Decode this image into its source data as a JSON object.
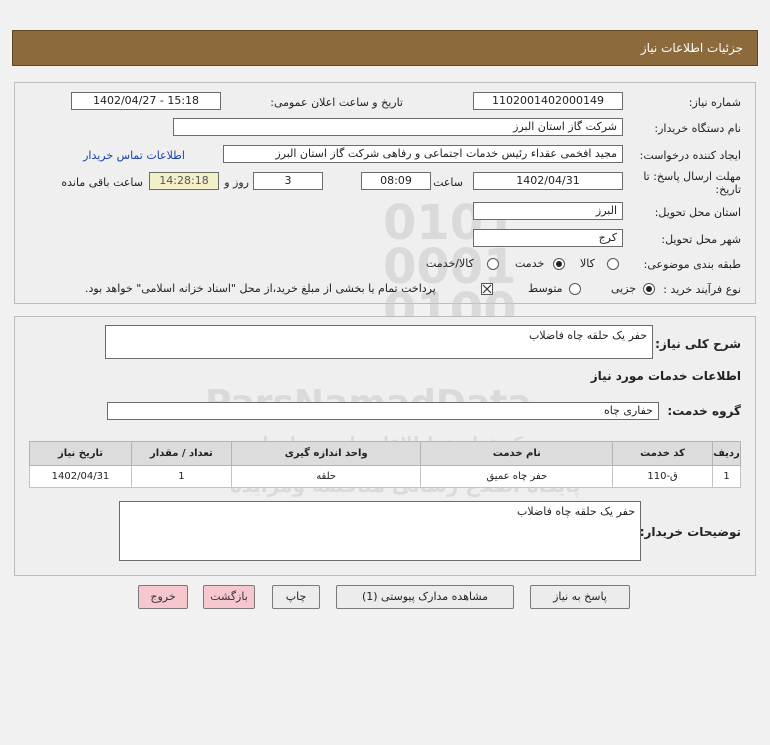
{
  "header": {
    "title": "جزئیات اطلاعات نیاز"
  },
  "need": {
    "number_label": "شماره نیاز:",
    "number_value": "1102001402000149",
    "announce_label": "تاریخ و ساعت اعلان عمومی:",
    "announce_value": "1402/04/27 - 15:18",
    "buyer_label": "نام دستگاه خریدار:",
    "buyer_value": "شرکت گاز استان البرز",
    "requester_label": "ایجاد کننده درخواست:",
    "requester_value": "مجید افخمی عقداء رئیس خدمات اجتماعی و رفاهی شرکت گاز استان البرز",
    "contact_link": "اطلاعات تماس خریدار",
    "deadline_label_1": "مهلت ارسال پاسخ: تا",
    "deadline_label_2": "تاریخ:",
    "deadline_date": "1402/04/31",
    "time_label": "ساعت",
    "deadline_time": "08:09",
    "days_value": "3",
    "days_label": "روز و",
    "remaining_time": "14:28:18",
    "remaining_label": "ساعت باقی مانده",
    "province_label": "استان محل تحویل:",
    "province_value": "البرز",
    "city_label": "شهر محل تحویل:",
    "city_value": "کرج",
    "category_label": "طبقه بندی موضوعی:",
    "category_options": [
      "کالا",
      "خدمت",
      "کالا/خدمت"
    ],
    "category_selected": "خدمت",
    "process_label": "نوع فرآیند خرید :",
    "process_options": [
      "جزیی",
      "متوسط"
    ],
    "process_selected": "جزیی",
    "payment_note": "پرداخت تمام یا بخشی از مبلغ خرید،از محل \"اسناد خزانه اسلامی\" خواهد بود."
  },
  "details": {
    "description_label": "شرح کلی نیاز:",
    "description_value": "حفر یک حلقه چاه فاضلاب",
    "services_title": "اطلاعات خدمات مورد نیاز",
    "service_group_label": "گروه خدمت:",
    "service_group_value": "حفاری چاه",
    "table": {
      "headers": [
        "ردیف",
        "کد خدمت",
        "نام خدمت",
        "واحد اندازه گیری",
        "تعداد / مقدار",
        "تاریخ نیاز"
      ],
      "rows": [
        [
          "1",
          "ق-110",
          "حفر چاه عمیق",
          "حلقه",
          "1",
          "1402/04/31"
        ]
      ]
    },
    "buyer_notes_label": "توضیحات خریدار:",
    "buyer_notes_value": "حفر یک حلقه چاه فاضلاب"
  },
  "buttons": {
    "reply": "پاسخ به نیاز",
    "attachments": "مشاهده مدارک پیوستی (1)",
    "print": "چاپ",
    "back": "بازگشت",
    "exit": "خروج"
  },
  "watermark": {
    "line1": "ParsNamadData",
    "line2": "مرکز فراوری اطلاعات پارس نماد داده",
    "line3": "پایگاه اطلاع رسانی مناقصه ومزایده",
    "phone": "۰۲۱-۸۸۳۴۹۶۷۰-۵"
  }
}
